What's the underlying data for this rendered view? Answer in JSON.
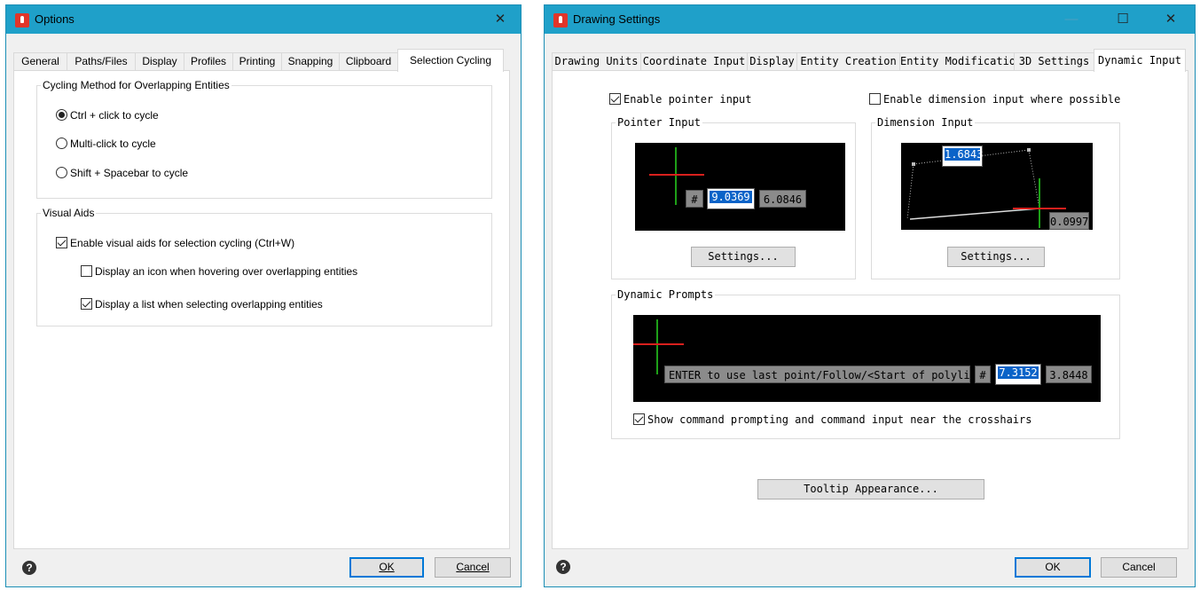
{
  "options_dialog": {
    "title": "Options",
    "close_glyph": "✕",
    "tabs": [
      "General",
      "Paths/Files",
      "Display",
      "Profiles",
      "Printing",
      "Snapping",
      "Clipboard",
      "Selection Cycling"
    ],
    "active_tab": "Selection Cycling",
    "cycling_group": {
      "legend": "Cycling Method for Overlapping Entities",
      "options": [
        "Ctrl + click to cycle",
        "Multi-click to cycle",
        "Shift + Spacebar to cycle"
      ],
      "selected": "Ctrl + click to cycle"
    },
    "visual_aids_group": {
      "legend": "Visual Aids",
      "enable_label": "Enable visual aids for selection cycling (Ctrl+W)",
      "enable_checked": true,
      "icon_label": "Display an icon when hovering over overlapping entities",
      "icon_checked": false,
      "list_label": "Display a list when selecting overlapping entities",
      "list_checked": true
    },
    "ok_label": "OK",
    "cancel_label": "Cancel",
    "help_glyph": "?"
  },
  "drawing_dialog": {
    "title": "Drawing Settings",
    "minimize_glyph": "—",
    "maximize_glyph": "☐",
    "close_glyph": "✕",
    "tabs": [
      "Drawing Units",
      "Coordinate Input",
      "Display",
      "Entity Creation",
      "Entity Modification",
      "3D Settings",
      "Dynamic Input"
    ],
    "active_tab": "Dynamic Input",
    "enable_pointer_label": "Enable pointer input",
    "enable_pointer_checked": true,
    "enable_dimension_label": "Enable dimension input where possible",
    "enable_dimension_checked": false,
    "pointer_group": {
      "legend": "Pointer Input",
      "hash": "#",
      "value1": "9.0369",
      "value2": "6.0846",
      "settings_label": "Settings..."
    },
    "dimension_group": {
      "legend": "Dimension Input",
      "value1": "1.6843",
      "value2": "0.0997",
      "settings_label": "Settings..."
    },
    "prompts_group": {
      "legend": "Dynamic Prompts",
      "prompt_text": "ENTER to use last point/Follow/<Start of polyline>:",
      "hash": "#",
      "value1": "7.3152",
      "value2": "3.8448",
      "show_label": "Show command prompting and command input near the crosshairs",
      "show_checked": true
    },
    "tooltip_label": "Tooltip Appearance...",
    "ok_label": "OK",
    "cancel_label": "Cancel",
    "help_glyph": "?"
  }
}
